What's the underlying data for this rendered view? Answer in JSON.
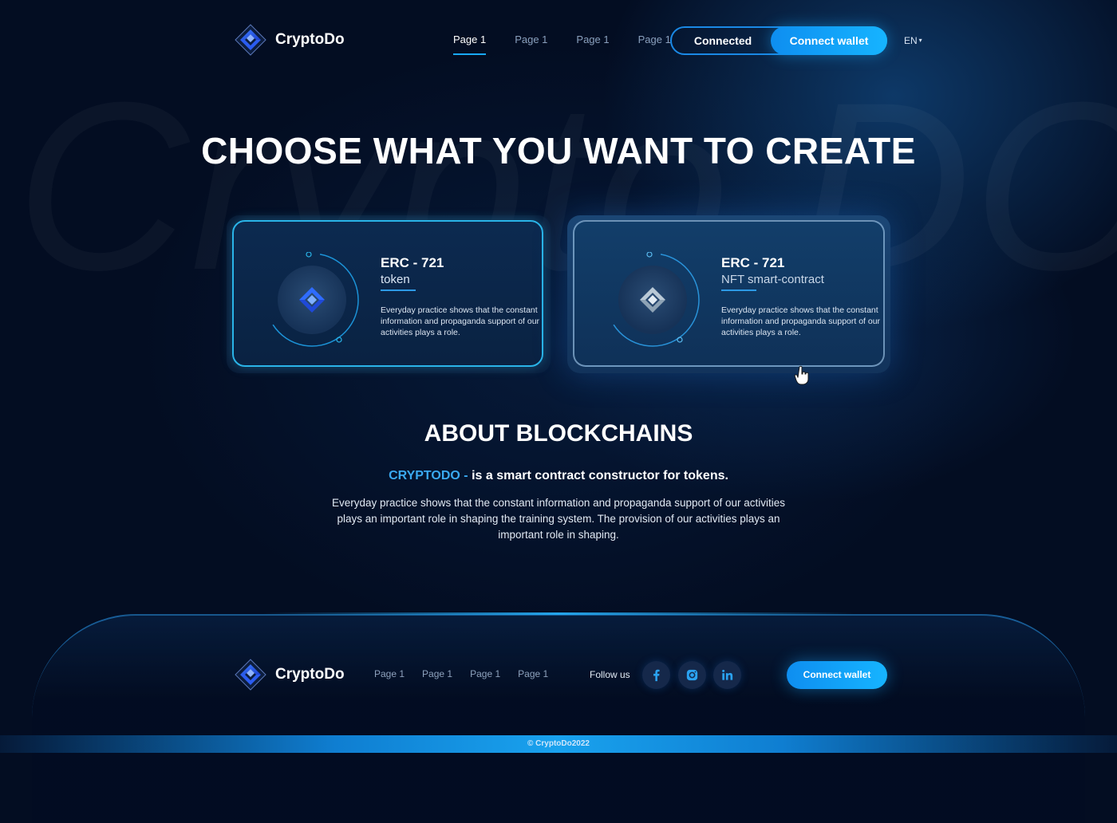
{
  "brand": {
    "name": "CryptoDo",
    "watermark": "Crypto DO"
  },
  "header": {
    "nav": [
      "Page 1",
      "Page 1",
      "Page 1",
      "Page 1"
    ],
    "active_index": 0,
    "connected_label": "Connected",
    "connect_label": "Connect wallet",
    "language": "EN",
    "language_icon": "caret-down-icon"
  },
  "hero": {
    "title": "CHOOSE WHAT YOU WANT TO CREATE"
  },
  "cards": [
    {
      "title": "ERC - 721",
      "subtitle": "token",
      "description": "Everyday practice shows that the constant information and propaganda support of our activities plays a role.",
      "icon": "cryptodo-logo-blue-icon"
    },
    {
      "title": "ERC - 721",
      "subtitle": "NFT smart-contract",
      "description": "Everyday practice shows that the constant information and propaganda support of our activities plays a role.",
      "icon": "cryptodo-logo-silver-icon"
    }
  ],
  "about": {
    "title": "ABOUT BLOCKCHAINS",
    "lead_brand": "CRYPTODO -",
    "lead_text": " is a smart contract constructor for tokens.",
    "body": "Everyday practice shows that the constant information and propaganda support of our activities plays an important role in shaping the training system. The provision of our activities plays an important role in shaping."
  },
  "footer": {
    "nav": [
      "Page 1",
      "Page 1",
      "Page 1",
      "Page 1"
    ],
    "follow_label": "Follow us",
    "social": [
      "facebook-icon",
      "instagram-icon",
      "linkedin-icon"
    ],
    "connect_label": "Connect wallet",
    "copyright": "© CryptoDo2022"
  },
  "colors": {
    "accent": "#16b4ff",
    "background": "#030d22",
    "brand_text": "#3aa9f0"
  }
}
